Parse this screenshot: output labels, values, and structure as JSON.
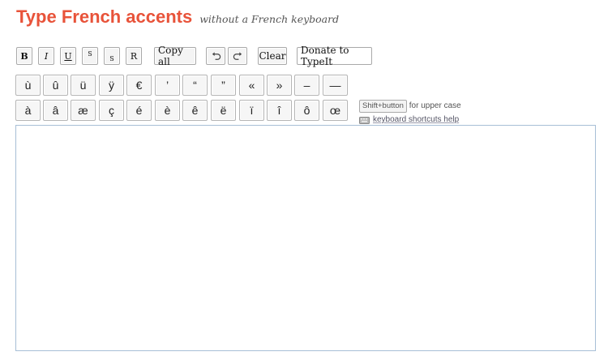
{
  "header": {
    "title": "Type French accents",
    "subtitle": "without a French keyboard"
  },
  "toolbar": {
    "bold": "B",
    "italic": "I",
    "underline": "U",
    "superscript": "S",
    "subscript": "S",
    "reset": "R",
    "copy_all": "Copy all",
    "clear": "Clear",
    "donate": "Donate to TypeIt"
  },
  "keys": {
    "row1": [
      "ù",
      "û",
      "ü",
      "ÿ",
      "€",
      "’",
      "“",
      "”",
      "«",
      "»",
      "–",
      "—"
    ],
    "row2": [
      "à",
      "â",
      "æ",
      "ç",
      "é",
      "è",
      "ê",
      "ë",
      "ï",
      "î",
      "ô",
      "œ"
    ]
  },
  "help": {
    "shift_key": "Shift+button",
    "shift_text": "for upper case",
    "shortcuts_link": "keyboard shortcuts help"
  },
  "editor": {
    "value": ""
  }
}
